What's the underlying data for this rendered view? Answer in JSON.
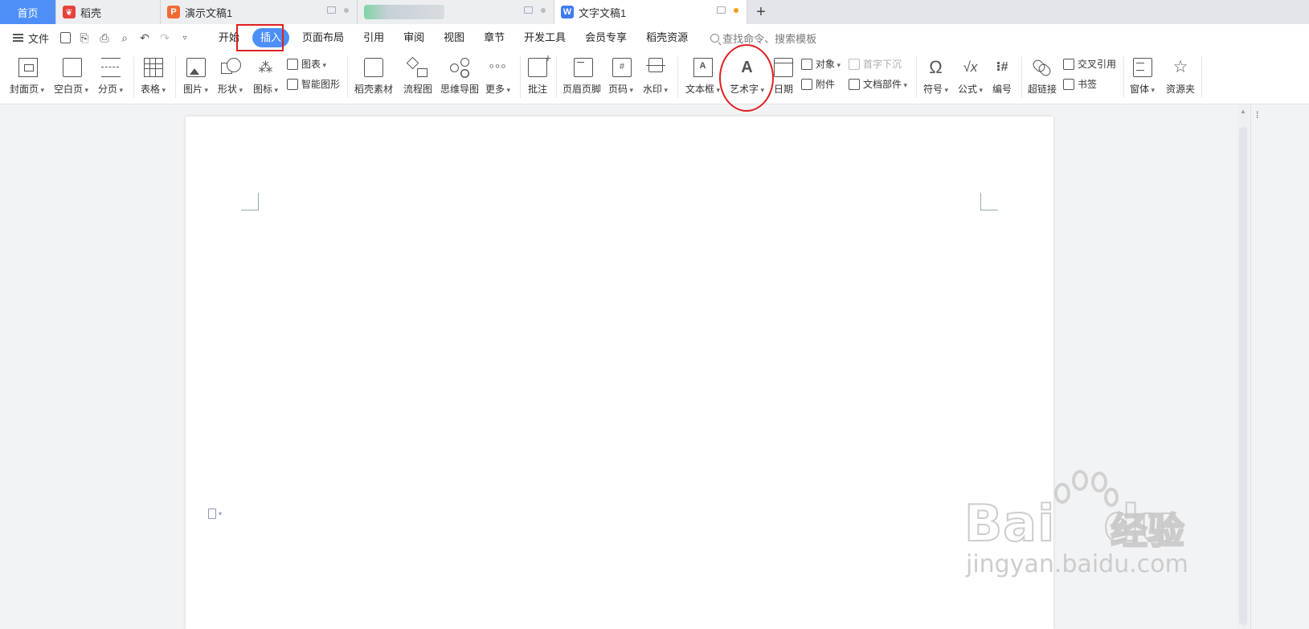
{
  "tabs": {
    "home": "首页",
    "t1": "稻壳",
    "t2": "演示文稿1",
    "active": "文字文稿1",
    "new": "+"
  },
  "menu": {
    "file": "文件",
    "tabs": [
      "开始",
      "插入",
      "页面布局",
      "引用",
      "审阅",
      "视图",
      "章节",
      "开发工具",
      "会员专享",
      "稻壳资源"
    ],
    "search_placeholder": "查找命令、搜索模板"
  },
  "ribbon": {
    "cover": "封面页",
    "blank": "空白页",
    "break": "分页",
    "table": "表格",
    "picture": "图片",
    "shape": "形状",
    "icons": "图标",
    "chart": "图表",
    "smart": "智能图形",
    "material": "稻壳素材",
    "flow": "流程图",
    "mind": "思维导图",
    "more": "更多",
    "comment": "批注",
    "header_footer": "页眉页脚",
    "page_num": "页码",
    "watermark": "水印",
    "textbox": "文本框",
    "wordart": "艺术字",
    "date": "日期",
    "object": "对象",
    "attach": "附件",
    "dropcap": "首字下沉",
    "docpart": "文档部件",
    "symbol": "符号",
    "formula": "公式",
    "numbering": "编号",
    "hyperlink": "超链接",
    "crossref": "交叉引用",
    "bookmark": "书签",
    "window": "窗体",
    "resource": "资源夹"
  },
  "watermark": {
    "logo": "Bai du 经验",
    "url": "jingyan.baidu.com"
  },
  "colors": {
    "accent": "#4d8ff7",
    "highlight": "#e02020"
  }
}
